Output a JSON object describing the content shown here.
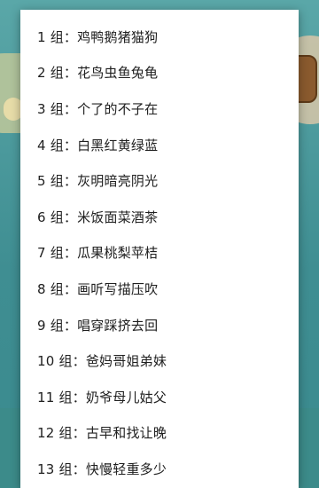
{
  "groups": [
    "1 组：鸡鸭鹅猪猫狗",
    "2 组：花鸟虫鱼兔龟",
    "3 组：个了的不子在",
    "4 组：白黑红黄绿蓝",
    "5 组：灰明暗亮阴光",
    "6 组：米饭面菜酒茶",
    "7 组：瓜果桃梨苹桔",
    "8 组：画听写描压吹",
    "9 组：唱穿踩挤去回",
    "10 组：爸妈哥姐弟妹",
    "11 组：奶爷母儿姑父",
    "12 组：古早和找让晚",
    "13 组：快慢轻重多少"
  ]
}
